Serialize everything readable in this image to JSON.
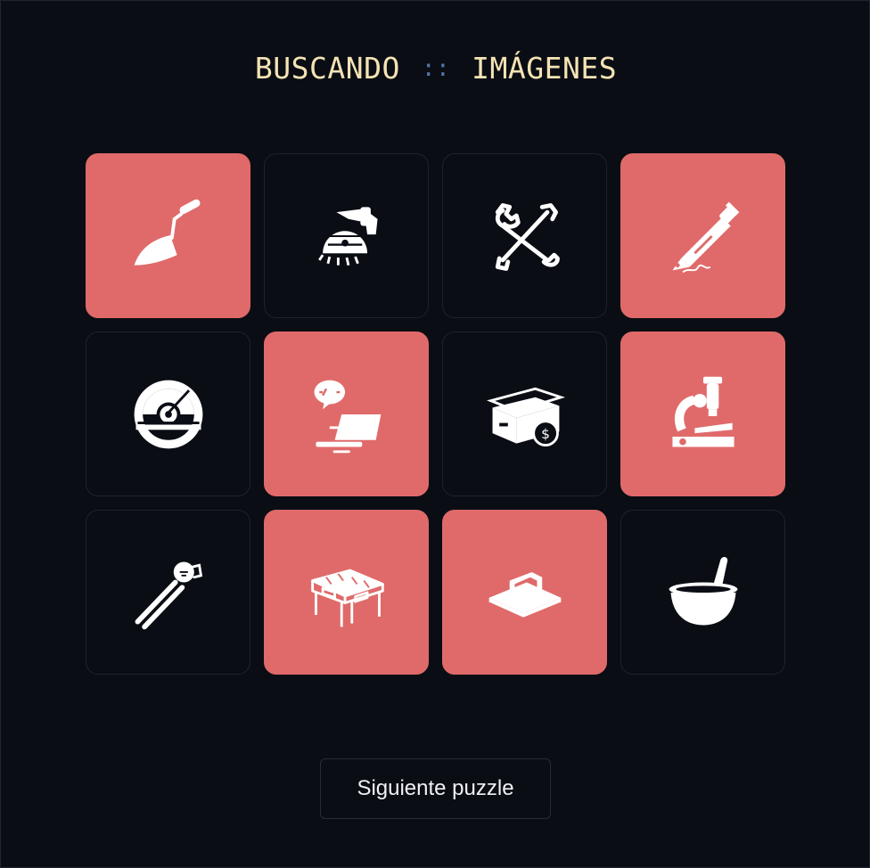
{
  "header": {
    "title_left": "BUSCANDO",
    "separator": "::",
    "title_right": "IMÁGENES"
  },
  "colors": {
    "background": "#0a0d14",
    "selected_tile": "#e06a6a",
    "title": "#f4e3b4",
    "separator": "#4d77a8"
  },
  "tiles": [
    {
      "icon": "trowel-icon",
      "selected": true
    },
    {
      "icon": "circular-saw-icon",
      "selected": false
    },
    {
      "icon": "crossed-wrenches-icon",
      "selected": false
    },
    {
      "icon": "fountain-pen-icon",
      "selected": true
    },
    {
      "icon": "saw-blade-icon",
      "selected": false
    },
    {
      "icon": "laptop-code-icon",
      "selected": true
    },
    {
      "icon": "money-box-icon",
      "selected": false
    },
    {
      "icon": "microscope-icon",
      "selected": true
    },
    {
      "icon": "pliers-icon",
      "selected": false
    },
    {
      "icon": "desk-icon",
      "selected": true
    },
    {
      "icon": "grout-float-icon",
      "selected": true
    },
    {
      "icon": "mortar-pestle-icon",
      "selected": false
    }
  ],
  "footer": {
    "next_button_label": "Siguiente puzzle"
  }
}
